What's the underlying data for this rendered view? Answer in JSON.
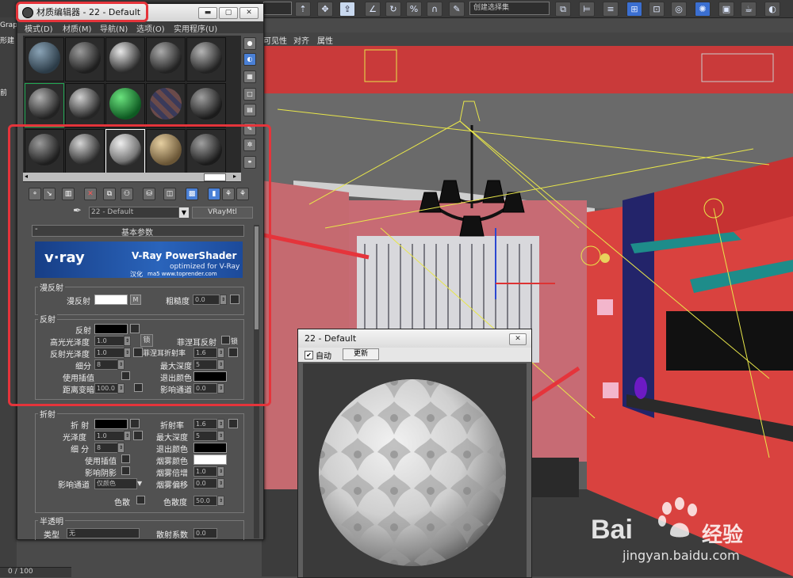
{
  "toolbar": {
    "selection_dropdown": "创建选择集",
    "icons": [
      "select-icon",
      "move-icon",
      "rotate-icon",
      "scale-icon",
      "snap-icon",
      "angle-snap-icon",
      "percent-snap-icon",
      "spinner-snap-icon",
      "named-selection-icon",
      "mirror-icon",
      "align-icon",
      "layer-icon",
      "curve-editor-icon",
      "schematic-icon",
      "material-editor-icon",
      "render-setup-icon",
      "render-icon",
      "teapot-icon"
    ]
  },
  "left_strip": {
    "labels": [
      "Grap",
      "形建",
      "前"
    ]
  },
  "viewport_bar": {
    "tabs": [
      "可见性",
      "对齐",
      "属性"
    ]
  },
  "material_editor": {
    "title": "材质编辑器 - 22 - Default",
    "menu": [
      "模式(D)",
      "材质(M)",
      "导航(N)",
      "选项(O)",
      "实用程序(U)"
    ],
    "material_name": "22 - Default",
    "material_type": "VRayMtl",
    "rollout_title": "基本参数",
    "vray_banner": {
      "logo": "v·ray",
      "title": "V-Ray PowerShader",
      "subtitle": "optimized for V-Ray",
      "credit_label": "汉化",
      "credit": "ma5  www.toprender.com"
    },
    "diffuse": {
      "section": "漫反射",
      "diffuse_label": "漫反射",
      "map_button": "M",
      "roughness_label": "粗糙度",
      "roughness_value": "0.0"
    },
    "reflection": {
      "section": "反射",
      "reflect_label": "反射",
      "hilight_gloss_label": "高光光泽度",
      "hilight_gloss_value": "1.0",
      "lock_label": "锁",
      "fresnel_label": "菲涅耳反射",
      "refl_gloss_label": "反射光泽度",
      "refl_gloss_value": "1.0",
      "fresnel_ior_label": "菲涅耳折射率",
      "fresnel_ior_value": "1.6",
      "subdivs_label": "细分",
      "subdivs_value": "8",
      "max_depth_label": "最大深度",
      "max_depth_value": "5",
      "use_interp_label": "使用插值",
      "exit_color_label": "退出颜色",
      "dim_distance_label": "距离变暗",
      "dim_distance_value": "100.0",
      "dim_falloff_label": "影响通道",
      "dim_falloff_value": "0.0"
    },
    "refraction": {
      "section": "折射",
      "refract_label": "折 射",
      "ior_label": "折射率",
      "ior_value": "1.6",
      "gloss_label": "光泽度",
      "gloss_value": "1.0",
      "max_depth_label": "最大深度",
      "max_depth_value": "5",
      "subdivs_label": "细 分",
      "subdivs_value": "8",
      "exit_color_label": "退出颜色",
      "use_interp_label": "使用插值",
      "fog_color_label": "烟雾颜色",
      "affect_shadows_label": "影响阴影",
      "fog_multiplier_label": "烟雾倍增",
      "fog_multiplier_value": "1.0",
      "affect_channels_label": "影响通道",
      "affect_channels_value": "仅颜色",
      "fog_bias_label": "烟雾偏移",
      "fog_bias_value": "0.0",
      "dispersion_label": "色散",
      "abbe_label": "色散度",
      "abbe_value": "50.0"
    },
    "translucency": {
      "section": "半透明",
      "type_label": "类型",
      "type_value": "无",
      "scatter_label": "散射系数",
      "scatter_value": "0.0"
    }
  },
  "preview_window": {
    "title": "22 - Default",
    "auto_label": "自动",
    "auto_checked": "✔",
    "update_button": "更新"
  },
  "status": {
    "frame": "0 / 100"
  },
  "watermark": {
    "brand": "Bai",
    "brand_cn": "经验",
    "url": "jingyan.baidu.com"
  },
  "colors": {
    "highlight": "#e5343b",
    "arrow": "#e5343b",
    "wall": "#d9423f"
  }
}
